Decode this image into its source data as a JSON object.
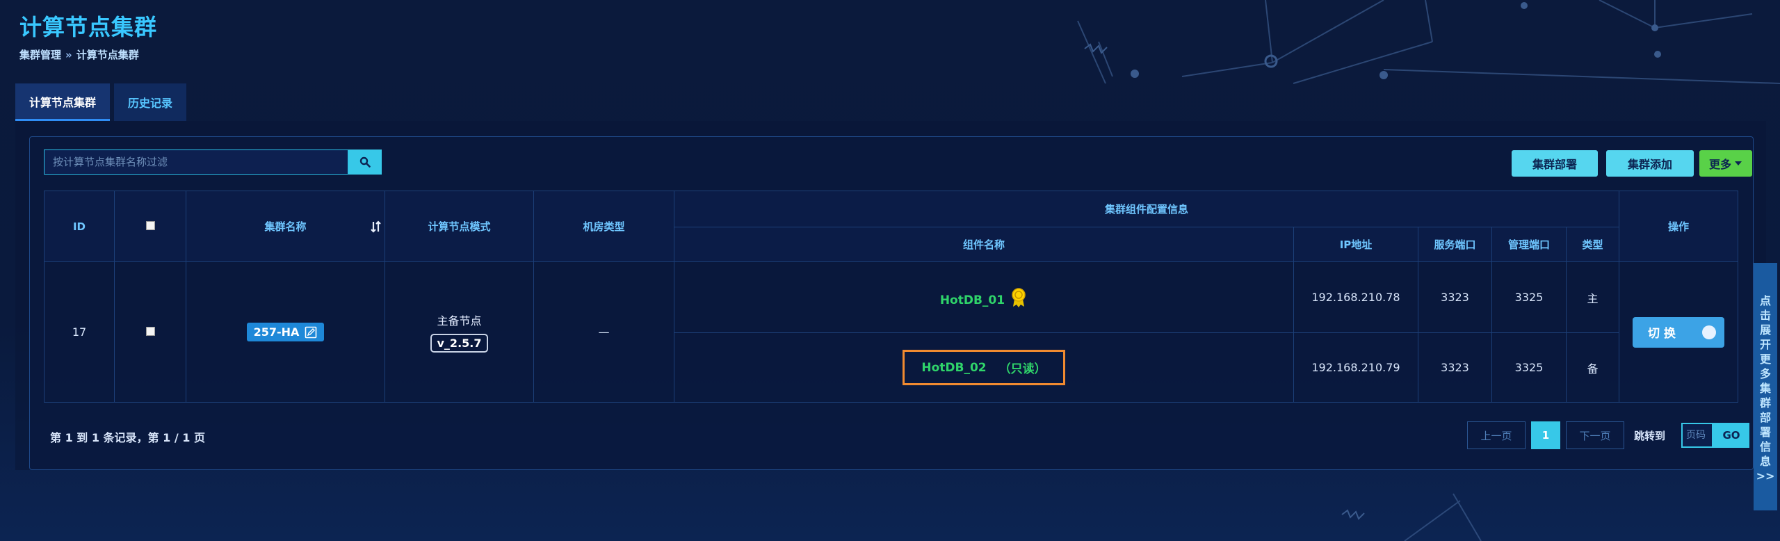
{
  "page": {
    "title": "计算节点集群",
    "breadcrumb": {
      "parent": "集群管理",
      "separator": "»",
      "current": "计算节点集群"
    }
  },
  "tabs": [
    {
      "label": "计算节点集群",
      "active": true
    },
    {
      "label": "历史记录",
      "active": false
    }
  ],
  "toolbar": {
    "search_placeholder": "按计算节点集群名称过滤",
    "deploy_label": "集群部署",
    "add_label": "集群添加",
    "more_label": "更多"
  },
  "table": {
    "headers": {
      "id": "ID",
      "name": "集群名称",
      "mode": "计算节点模式",
      "room_type": "机房类型",
      "config_group": "集群组件配置信息",
      "component_name": "组件名称",
      "ip": "IP地址",
      "service_port": "服务端口",
      "manage_port": "管理端口",
      "type": "类型",
      "action": "操作"
    },
    "rows": [
      {
        "id": "17",
        "cluster_name": "257-HA",
        "mode": "主备节点",
        "version": "v_2.5.7",
        "room_type": "—",
        "components": [
          {
            "name": "HotDB_01",
            "readonly_tag": "",
            "ip": "192.168.210.78",
            "service_port": "3323",
            "manage_port": "3325",
            "type": "主",
            "master_badge_icon": "medal-icon"
          },
          {
            "name": "HotDB_02",
            "readonly_tag": "（只读）",
            "ip": "192.168.210.79",
            "service_port": "3323",
            "manage_port": "3325",
            "type": "备"
          }
        ],
        "action_label": "切 换"
      }
    ]
  },
  "pagination": {
    "summary": "第 1 到 1 条记录，第 1 / 1 页",
    "prev_label": "上一页",
    "current_page": "1",
    "next_label": "下一页",
    "jump_label": "跳转到",
    "page_input_placeholder": "页码",
    "go_label": "GO"
  },
  "side_panel": {
    "chars": [
      "点",
      "击",
      "展",
      "开",
      "更",
      "多",
      "集",
      "群",
      "部",
      "署",
      "信",
      "息",
      ">>"
    ]
  },
  "colors": {
    "accent": "#37c8e8",
    "title": "#39c8ff",
    "component_name": "#2fd46a",
    "highlight_border": "#f08a30",
    "more_button": "#59d148"
  }
}
